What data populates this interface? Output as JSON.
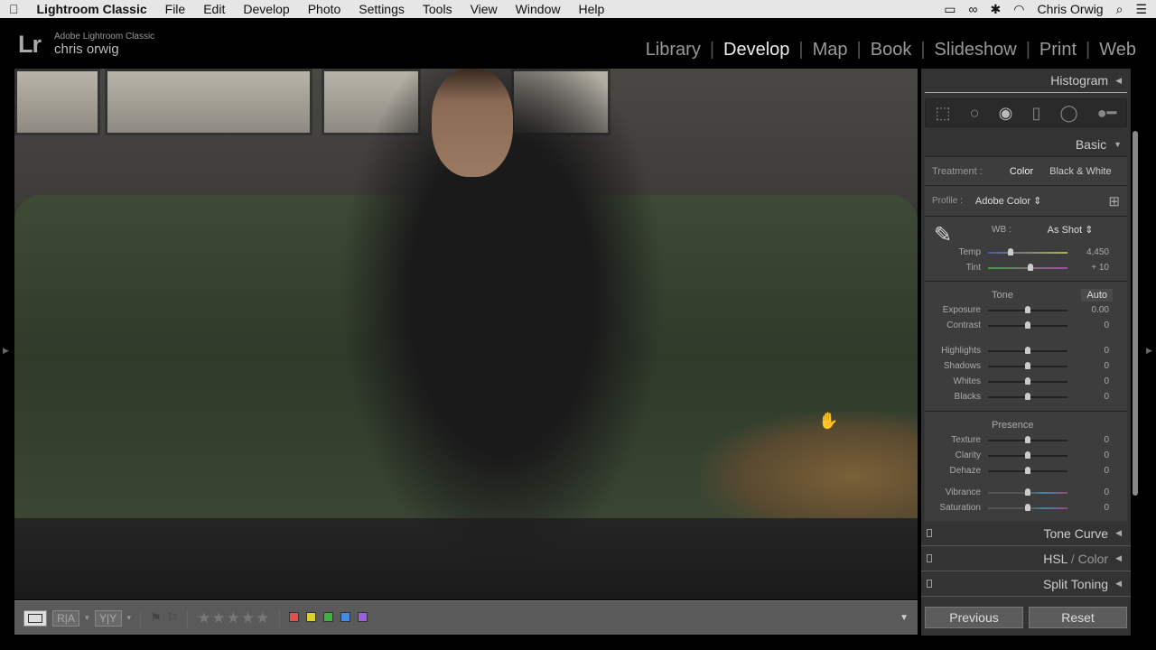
{
  "menubar": {
    "app": "Lightroom Classic",
    "items": [
      "File",
      "Edit",
      "Develop",
      "Photo",
      "Settings",
      "Tools",
      "View",
      "Window",
      "Help"
    ],
    "user": "Chris Orwig"
  },
  "header": {
    "logo": "Lr",
    "product": "Adobe Lightroom Classic",
    "user": "chris orwig",
    "modules": [
      "Library",
      "Develop",
      "Map",
      "Book",
      "Slideshow",
      "Print",
      "Web"
    ],
    "active_module": "Develop"
  },
  "toolbar": {
    "view_compare_a": "R|A",
    "view_compare_b": "Y|Y",
    "stars": 5,
    "colors": [
      "#e05050",
      "#d8d030",
      "#40b040",
      "#4a88e0",
      "#9a60e0"
    ]
  },
  "panel": {
    "histogram": "Histogram",
    "basic": "Basic",
    "treatment_label": "Treatment :",
    "treatment_color": "Color",
    "treatment_bw": "Black & White",
    "profile_label": "Profile :",
    "profile_value": "Adobe Color",
    "wb_label": "WB :",
    "wb_value": "As Shot",
    "wb_sliders": [
      {
        "label": "Temp",
        "value": "4,450",
        "position": 0.28
      },
      {
        "label": "Tint",
        "value": "+ 10",
        "position": 0.53
      }
    ],
    "tone_label": "Tone",
    "auto": "Auto",
    "tone_sliders": [
      {
        "label": "Exposure",
        "value": "0.00",
        "position": 0.5
      },
      {
        "label": "Contrast",
        "value": "0",
        "position": 0.5
      }
    ],
    "tone_sliders2": [
      {
        "label": "Highlights",
        "value": "0",
        "position": 0.5
      },
      {
        "label": "Shadows",
        "value": "0",
        "position": 0.5
      },
      {
        "label": "Whites",
        "value": "0",
        "position": 0.5
      },
      {
        "label": "Blacks",
        "value": "0",
        "position": 0.5
      }
    ],
    "presence_label": "Presence",
    "presence_sliders": [
      {
        "label": "Texture",
        "value": "0",
        "position": 0.5
      },
      {
        "label": "Clarity",
        "value": "0",
        "position": 0.5
      },
      {
        "label": "Dehaze",
        "value": "0",
        "position": 0.5
      }
    ],
    "presence_sliders2": [
      {
        "label": "Vibrance",
        "value": "0",
        "position": 0.5
      },
      {
        "label": "Saturation",
        "value": "0",
        "position": 0.5
      }
    ],
    "tone_curve": "Tone Curve",
    "hsl": "HSL",
    "hsl_color": "Color",
    "split_toning": "Split Toning",
    "previous": "Previous",
    "reset": "Reset"
  }
}
